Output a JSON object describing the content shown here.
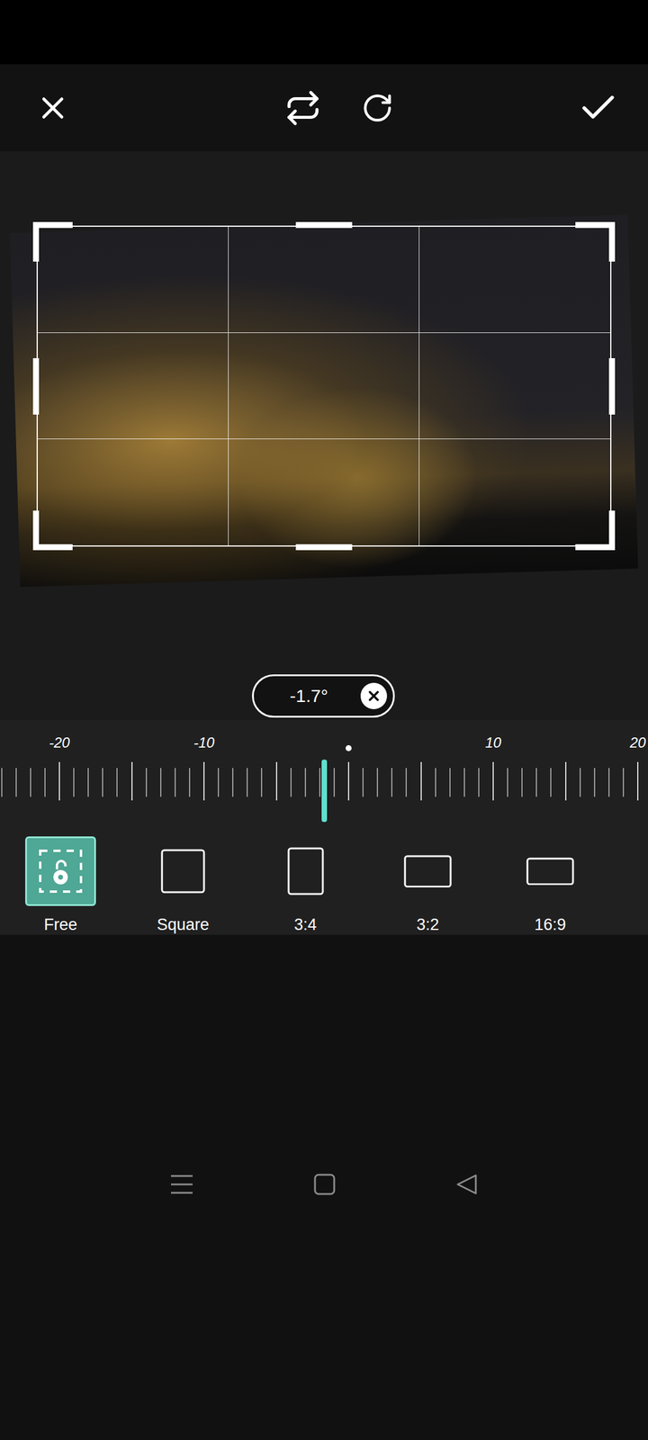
{
  "angle": {
    "reading": "-1.7°"
  },
  "ruler": {
    "level": 0.5,
    "labels": [
      "-20",
      "-10",
      "10",
      "20"
    ]
  },
  "aspect_options": [
    {
      "label": "Free",
      "kind": "free",
      "selected": true
    },
    {
      "label": "Square",
      "kind": "square",
      "selected": false
    },
    {
      "label": "3:4",
      "kind": "ratio",
      "selected": false
    },
    {
      "label": "3:2",
      "kind": "ratio",
      "selected": false
    },
    {
      "label": "16:9",
      "kind": "ratio",
      "selected": false
    }
  ]
}
